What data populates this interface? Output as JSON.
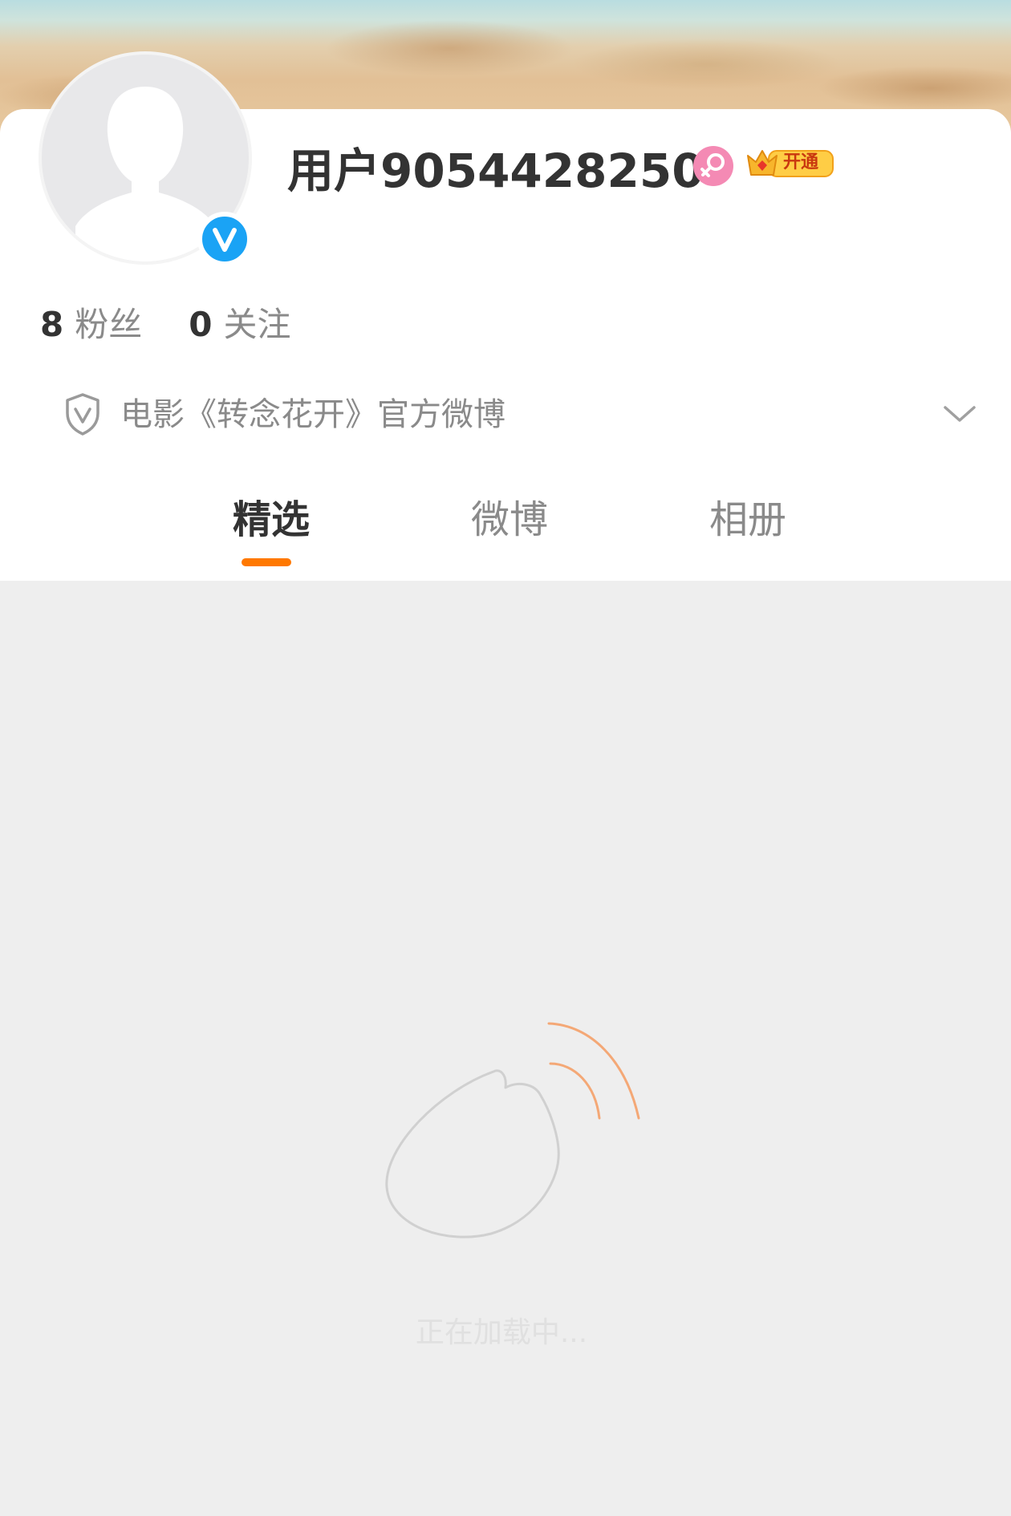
{
  "profile": {
    "username": "用户9054428250",
    "vip_label": "开通",
    "followers_count": "8",
    "followers_label": "粉丝",
    "following_count": "0",
    "following_label": "关注",
    "verification": "电影《转念花开》官方微博"
  },
  "icons": {
    "avatar": "default-avatar-icon",
    "verified": "verified-v-icon",
    "gender": "female-gender-icon",
    "vip": "vip-crown-icon",
    "verification": "shield-icon",
    "expand": "chevron-down-icon",
    "loader": "weibo-logo-icon"
  },
  "tabs": [
    {
      "label": "精选",
      "active": true
    },
    {
      "label": "微博",
      "active": false
    },
    {
      "label": "相册",
      "active": false
    }
  ],
  "loading": {
    "text": "正在加载中..."
  },
  "colors": {
    "accent": "#ff7800",
    "verified": "#1aa3f5",
    "gender": "#f48ab4",
    "vip": "#f7b52c",
    "background": "#eeeeee"
  }
}
